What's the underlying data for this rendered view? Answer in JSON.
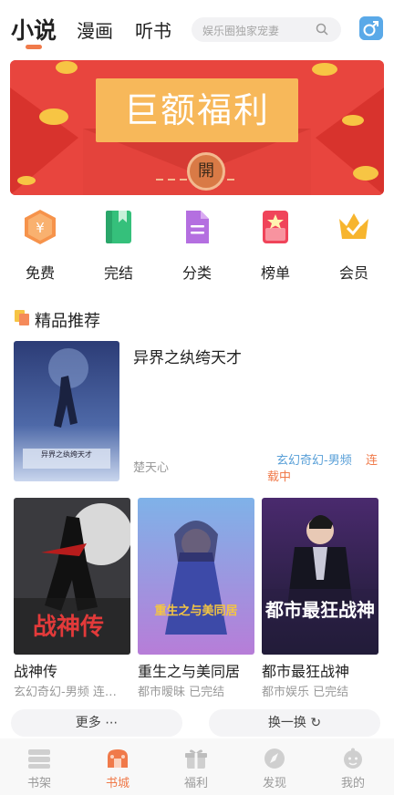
{
  "top_tabs": [
    {
      "label": "小说",
      "active": true
    },
    {
      "label": "漫画",
      "active": false
    },
    {
      "label": "听书",
      "active": false
    }
  ],
  "search": {
    "placeholder": "娱乐圈独家宠妻",
    "icon": "search-icon"
  },
  "gender_toggle": {
    "icon": "male-symbol-icon"
  },
  "banner": {
    "title": "巨额福利",
    "open_label": "開"
  },
  "categories": [
    {
      "label": "免费",
      "icon": "yuan-coin-icon"
    },
    {
      "label": "完结",
      "icon": "closed-book-icon"
    },
    {
      "label": "分类",
      "icon": "document-icon"
    },
    {
      "label": "榜单",
      "icon": "rank-star-icon"
    },
    {
      "label": "会员",
      "icon": "crown-icon"
    }
  ],
  "section": {
    "title": "精品推荐"
  },
  "featured": {
    "title": "异界之纨绔天才",
    "author": "楚天心",
    "genre": "玄幻奇幻-男频",
    "status_line1": "连",
    "status_line2": "载中",
    "cover_text": "异界之纨绔天才"
  },
  "books": [
    {
      "title": "战神传",
      "meta": "玄幻奇幻-男频 连…",
      "cover_text": "战神传"
    },
    {
      "title": "重生之与美同居",
      "meta": "都市暧昧 已完结",
      "cover_text": "重生之与美同居"
    },
    {
      "title": "都市最狂战神",
      "meta": "都市娱乐 已完结",
      "cover_text": "都市最狂战神"
    }
  ],
  "buttons": {
    "more": "更多 ⋯",
    "refresh": "换一换 ↻"
  },
  "nav": [
    {
      "label": "书架",
      "icon": "bookshelf-icon",
      "active": false
    },
    {
      "label": "书城",
      "icon": "bookstore-icon",
      "active": true
    },
    {
      "label": "福利",
      "icon": "gift-icon",
      "active": false
    },
    {
      "label": "发现",
      "icon": "discover-icon",
      "active": false
    },
    {
      "label": "我的",
      "icon": "profile-icon",
      "active": false
    }
  ],
  "colors": {
    "accent": "#f07a4a",
    "banner_red": "#e8453e",
    "genre_blue": "#5aa0d8"
  }
}
